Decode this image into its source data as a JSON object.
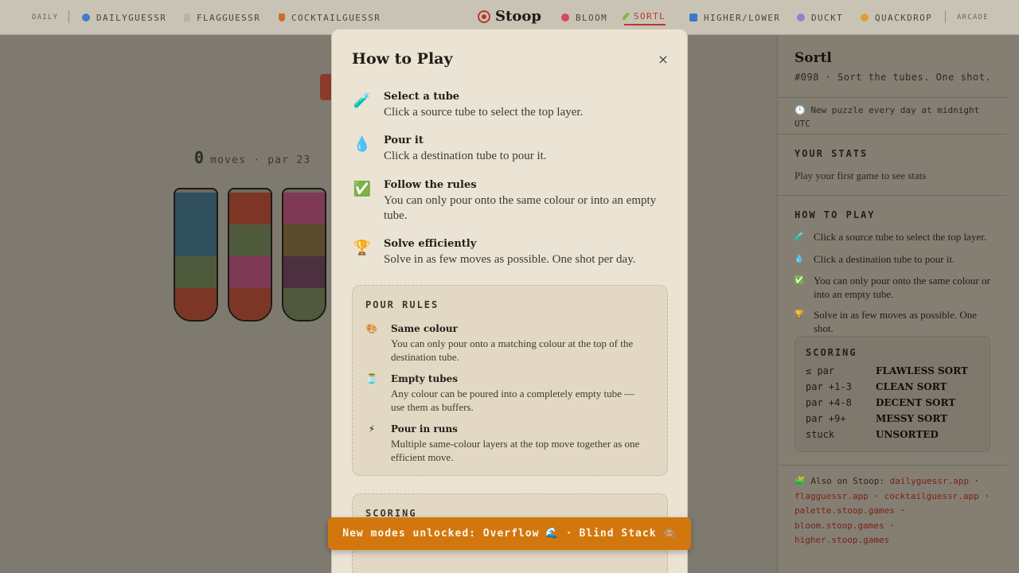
{
  "nav": {
    "daily_label": "DAILY",
    "items_left": [
      {
        "label": "DAILYGUESSR",
        "icon": "globe-icon",
        "color": "#3b7fc8"
      },
      {
        "label": "FLAGGUESSR",
        "icon": "flag-icon",
        "color": "#8f8a80"
      },
      {
        "label": "COCKTAILGUESSR",
        "icon": "cocktail-icon",
        "color": "#c9702a"
      }
    ],
    "brand": "Stoop",
    "items_right": [
      {
        "label": "BLOOM",
        "icon": "flower-icon",
        "color": "#d8485f"
      },
      {
        "label": "SORTL",
        "icon": "test-tube-icon",
        "color": "#7fb845",
        "active": true
      },
      {
        "label": "HIGHER/LOWER",
        "icon": "arrows-icon",
        "color": "#3a77c9"
      },
      {
        "label": "DUCKT",
        "icon": "duck-icon",
        "color": "#9a7ad6"
      },
      {
        "label": "QUACKDROP",
        "icon": "drop-icon",
        "color": "#e0a030"
      }
    ],
    "arcade_label": "ARCADE",
    "accent_color": "#b8382a"
  },
  "game": {
    "moves": "0",
    "par_text": "moves · par 23",
    "tubes": [
      {
        "layers": [
          "#2f4f5c",
          "#2f4f5c",
          "#4f5a3c",
          "#7d3626"
        ]
      },
      {
        "layers": [
          "#7d3626",
          "#4f5a3c",
          "#7e3a55",
          "#7d3626"
        ]
      },
      {
        "layers": [
          "#7e3a55",
          "#5a4b2c",
          "#4c3040",
          "#4f5a3c"
        ]
      }
    ]
  },
  "modal": {
    "title": "How to Play",
    "close_label": "×",
    "steps": [
      {
        "icon": "test-tube-icon",
        "glyph": "🧪",
        "title": "Select a tube",
        "desc": "Click a source tube to select the top layer."
      },
      {
        "icon": "droplet-icon",
        "glyph": "💧",
        "title": "Pour it",
        "desc": "Click a destination tube to pour it."
      },
      {
        "icon": "checkmark-icon",
        "glyph": "✅",
        "title": "Follow the rules",
        "desc": "You can only pour onto the same colour or into an empty tube."
      },
      {
        "icon": "trophy-icon",
        "glyph": "🏆",
        "title": "Solve efficiently",
        "desc": "Solve in as few moves as possible. One shot per day."
      }
    ],
    "pour_rules_heading": "POUR RULES",
    "pour_rules": [
      {
        "icon": "palette-icon",
        "glyph": "🎨",
        "title": "Same colour",
        "desc": "You can only pour onto a matching colour at the top of the destination tube."
      },
      {
        "icon": "empty-jar-icon",
        "glyph": "🫙",
        "title": "Empty tubes",
        "desc": "Any colour can be poured into a completely empty tube — use them as buffers."
      },
      {
        "icon": "lightning-icon",
        "glyph": "⚡",
        "title": "Pour in runs",
        "desc": "Multiple same-colour layers at the top move together as one efficient move."
      }
    ],
    "scoring_heading": "SCORING"
  },
  "banner": {
    "text": "New modes unlocked: Overflow",
    "glyph1": "🌊",
    "sep": "·",
    "text2": "Blind Stack",
    "glyph2": "🙈",
    "color": "#d2770e"
  },
  "sidebar": {
    "title": "Sortl",
    "subtitle": "#098 · Sort the tubes. One shot.",
    "note": "🕛 New puzzle every day at midnight UTC",
    "stats_heading": "YOUR STATS",
    "stats_text": "Play your first game to see stats",
    "how_heading": "HOW TO PLAY",
    "how_steps": [
      {
        "icon": "test-tube-icon",
        "glyph": "🧪",
        "desc": "Click a source tube to select the top layer."
      },
      {
        "icon": "droplet-icon",
        "glyph": "💧",
        "desc": "Click a destination tube to pour it."
      },
      {
        "icon": "checkmark-icon",
        "glyph": "✅",
        "desc": "You can only pour onto the same colour or into an empty tube."
      },
      {
        "icon": "trophy-icon",
        "glyph": "🏆",
        "desc": "Solve in as few moves as possible. One shot."
      }
    ],
    "scoring_heading": "SCORING",
    "scoring": [
      {
        "k": "≤ par",
        "v": "FLAWLESS SORT"
      },
      {
        "k": "par +1-3",
        "v": "CLEAN SORT"
      },
      {
        "k": "par +4-8",
        "v": "DECENT SORT"
      },
      {
        "k": "par +9+",
        "v": "MESSY SORT"
      },
      {
        "k": "stuck",
        "v": "UNSORTED"
      }
    ],
    "also_prefix": "🧩 Also on Stoop:",
    "links": [
      "dailyguessr.app",
      "flagguessr.app",
      "cocktailguessr.app",
      "palette.stoop.games",
      "bloom.stoop.games",
      "higher.stoop.games"
    ]
  }
}
